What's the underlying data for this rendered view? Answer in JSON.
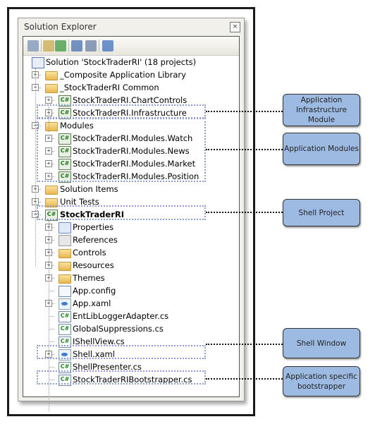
{
  "panel": {
    "title": "Solution Explorer",
    "close_icon": "close-icon"
  },
  "toolbar": [
    {
      "name": "properties-icon",
      "color": "#7a93b8"
    },
    {
      "name": "show-all-files-icon",
      "color": "#c9a94a"
    },
    {
      "name": "refresh-icon",
      "color": "#3d9a3d"
    },
    {
      "name": "view-code-icon",
      "color": "#4a6fb0"
    },
    {
      "name": "class-diagram-icon",
      "color": "#6a7fa5"
    },
    {
      "name": "copy-website-icon",
      "color": "#3f70c0"
    }
  ],
  "tree": [
    {
      "label": "Solution 'StockTraderRI' (18 projects)",
      "level": 0,
      "icon": "sln",
      "exp": ""
    },
    {
      "label": "_Composite Application Library",
      "level": 1,
      "icon": "folder",
      "exp": "+"
    },
    {
      "label": "_StockTraderRI Common",
      "level": 1,
      "icon": "folder",
      "exp": "-"
    },
    {
      "label": "StockTraderRI.ChartControls",
      "level": 2,
      "icon": "proj",
      "exp": "+"
    },
    {
      "label": "StockTraderRI.Infrastructure",
      "level": 2,
      "icon": "proj",
      "exp": "+"
    },
    {
      "label": "Modules",
      "level": 1,
      "icon": "folder",
      "exp": "-"
    },
    {
      "label": "StockTraderRI.Modules.Watch",
      "level": 2,
      "icon": "proj",
      "exp": "+"
    },
    {
      "label": "StockTraderRI.Modules.News",
      "level": 2,
      "icon": "proj",
      "exp": "+"
    },
    {
      "label": "StockTraderRI.Modules.Market",
      "level": 2,
      "icon": "proj",
      "exp": "+"
    },
    {
      "label": "StockTraderRI.Modules.Position",
      "level": 2,
      "icon": "proj",
      "exp": "+"
    },
    {
      "label": "Solution Items",
      "level": 1,
      "icon": "folder",
      "exp": "+"
    },
    {
      "label": "Unit Tests",
      "level": 1,
      "icon": "folder",
      "exp": "+"
    },
    {
      "label": "StockTraderRI",
      "level": 1,
      "icon": "proj",
      "exp": "-",
      "bold": true
    },
    {
      "label": "Properties",
      "level": 2,
      "icon": "props",
      "exp": "+"
    },
    {
      "label": "References",
      "level": 2,
      "icon": "refs",
      "exp": "+"
    },
    {
      "label": "Controls",
      "level": 2,
      "icon": "folder",
      "exp": "+"
    },
    {
      "label": "Resources",
      "level": 2,
      "icon": "folder",
      "exp": "+"
    },
    {
      "label": "Themes",
      "level": 2,
      "icon": "folder",
      "exp": "+"
    },
    {
      "label": "App.config",
      "level": 2,
      "icon": "cfg",
      "exp": ""
    },
    {
      "label": "App.xaml",
      "level": 2,
      "icon": "xaml",
      "exp": "+"
    },
    {
      "label": "EntLibLoggerAdapter.cs",
      "level": 2,
      "icon": "cs",
      "exp": ""
    },
    {
      "label": "GlobalSuppressions.cs",
      "level": 2,
      "icon": "cs",
      "exp": ""
    },
    {
      "label": "IShellView.cs",
      "level": 2,
      "icon": "cs",
      "exp": ""
    },
    {
      "label": "Shell.xaml",
      "level": 2,
      "icon": "xaml",
      "exp": "+"
    },
    {
      "label": "ShellPresenter.cs",
      "level": 2,
      "icon": "cs",
      "exp": ""
    },
    {
      "label": "StockTraderRIBootstrapper.cs",
      "level": 2,
      "icon": "cs",
      "exp": ""
    }
  ],
  "callouts": [
    {
      "text": "Application Infrastructure Module"
    },
    {
      "text": "Application Modules"
    },
    {
      "text": "Shell Project"
    },
    {
      "text": "Shell Window"
    },
    {
      "text": "Application specific bootstrapper"
    }
  ],
  "colors": {
    "callout_fill": "#9dbbe2",
    "highlight_dotted": "#8f9fd0"
  }
}
